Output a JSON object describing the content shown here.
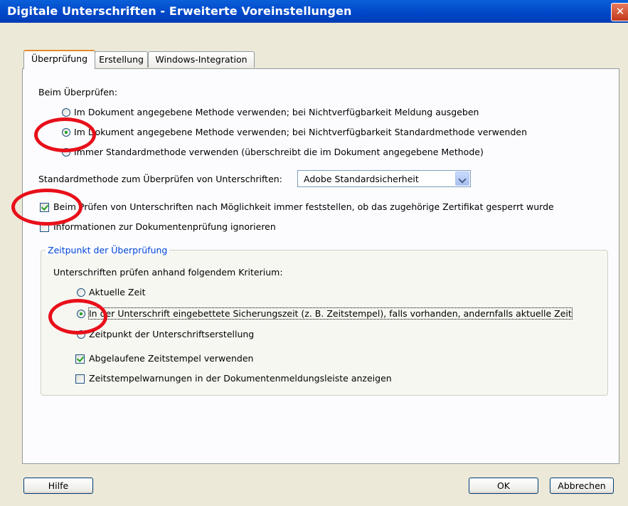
{
  "window": {
    "title": "Digitale Unterschriften - Erweiterte Voreinstellungen",
    "close_glyph": "✕"
  },
  "tabs": [
    {
      "label": "Überprüfung",
      "active": true
    },
    {
      "label": "Erstellung",
      "active": false
    },
    {
      "label": "Windows-Integration",
      "active": false
    }
  ],
  "verify": {
    "heading": "Beim Überprüfen:",
    "options": [
      {
        "label": "Im Dokument angegebene Methode verwenden; bei Nichtverfügbarkeit Meldung ausgeben",
        "checked": false
      },
      {
        "label": "Im Dokument angegebene Methode verwenden; bei Nichtverfügbarkeit Standardmethode verwenden",
        "checked": true
      },
      {
        "label": "Immer Standardmethode verwenden (überschreibt die im Dokument angegebene Methode)",
        "checked": false
      }
    ]
  },
  "default_method": {
    "label": "Standardmethode zum Überprüfen von Unterschriften:",
    "value": "Adobe Standardsicherheit"
  },
  "checkboxes": [
    {
      "label": "Beim Prüfen von Unterschriften nach Möglichkeit immer feststellen, ob das zugehörige Zertifikat gesperrt wurde",
      "checked": true
    },
    {
      "label": "Informationen zur Dokumentenprüfung ignorieren",
      "checked": false
    }
  ],
  "time_group": {
    "title": "Zeitpunkt der Überprüfung",
    "criterion_label": "Unterschriften prüfen anhand folgendem Kriterium:",
    "options": [
      {
        "label": "Aktuelle Zeit",
        "checked": false
      },
      {
        "label": "In der Unterschrift eingebettete Sicherungszeit (z. B. Zeitstempel), falls vorhanden, andernfalls aktuelle Zeit",
        "checked": true
      },
      {
        "label": "Zeitpunkt der Unterschriftserstellung",
        "checked": false
      }
    ],
    "checkboxes": [
      {
        "label": "Abgelaufene Zeitstempel verwenden",
        "checked": true
      },
      {
        "label": "Zeitstempelwarnungen in der Dokumentenmeldungsleiste anzeigen",
        "checked": false
      }
    ]
  },
  "buttons": {
    "help": "Hilfe",
    "ok": "OK",
    "cancel": "Abbrechen"
  },
  "annotation_color": "#e8101a"
}
